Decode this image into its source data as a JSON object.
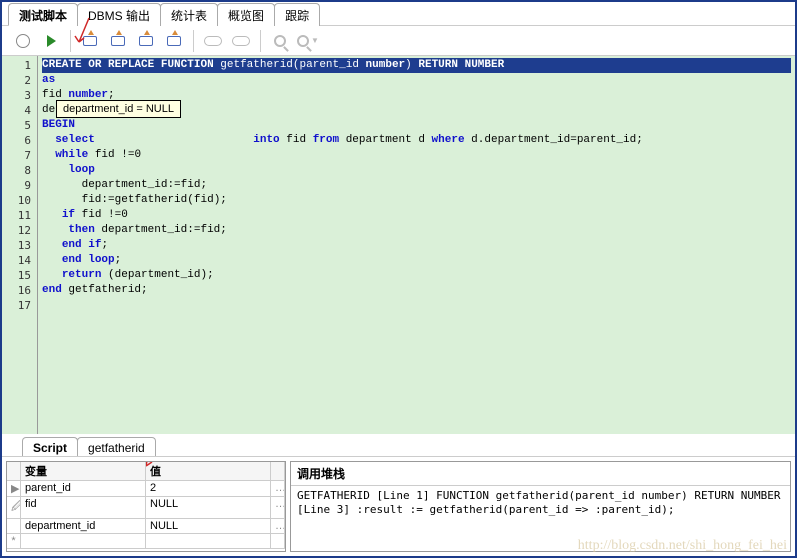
{
  "top_tabs": [
    "测试脚本",
    "DBMS 输出",
    "统计表",
    "概览图",
    "跟踪"
  ],
  "code": {
    "lines": [
      {
        "n": 1,
        "t": "CREATE OR REPLACE FUNCTION getfatherid(parent_id number) RETURN NUMBER",
        "hl": true
      },
      {
        "n": 2,
        "t": "as"
      },
      {
        "n": 3,
        "t": "fid number;"
      },
      {
        "n": 4,
        "t": "department_id number;"
      },
      {
        "n": 5,
        "t": "BEGIN"
      },
      {
        "n": 6,
        "t": "  select                        into fid from department d where d.department_id=parent_id;"
      },
      {
        "n": 7,
        "t": "  while fid !=0"
      },
      {
        "n": 8,
        "t": "    loop"
      },
      {
        "n": 9,
        "t": "      department_id:=fid;"
      },
      {
        "n": 10,
        "t": "      fid:=getfatherid(fid);"
      },
      {
        "n": 11,
        "t": ""
      },
      {
        "n": 12,
        "t": "   if fid !=0"
      },
      {
        "n": 13,
        "t": "    then department_id:=fid;"
      },
      {
        "n": 14,
        "t": "   end if;"
      },
      {
        "n": 15,
        "t": "   end loop;"
      },
      {
        "n": 16,
        "t": "   return (department_id);"
      },
      {
        "n": 17,
        "t": "end getfatherid;"
      }
    ],
    "keywords": [
      "CREATE",
      "OR",
      "REPLACE",
      "FUNCTION",
      "number",
      "RETURN",
      "NUMBER",
      "as",
      "BEGIN",
      "select",
      "into",
      "from",
      "where",
      "while",
      "loop",
      "if",
      "then",
      "end",
      "return"
    ]
  },
  "tooltip": "department_id = NULL",
  "mid_tabs": [
    "Script",
    "getfatherid"
  ],
  "vars": {
    "header": [
      "变量",
      "值"
    ],
    "rows": [
      {
        "name": "parent_id",
        "val": "2",
        "mark": "▶"
      },
      {
        "name": "fid",
        "val": "NULL",
        "mark": "🖉"
      },
      {
        "name": "department_id",
        "val": "NULL",
        "mark": ""
      }
    ],
    "new_row": "*"
  },
  "stack": {
    "header": "调用堆栈",
    "lines": [
      "GETFATHERID [Line 1] FUNCTION getfatherid(parent_id number) RETURN NUMBER",
      "[Line 3]   :result := getfatherid(parent_id => :parent_id);"
    ]
  },
  "watermark": "http://blog.csdn.net/shi_hong_fei_hei"
}
